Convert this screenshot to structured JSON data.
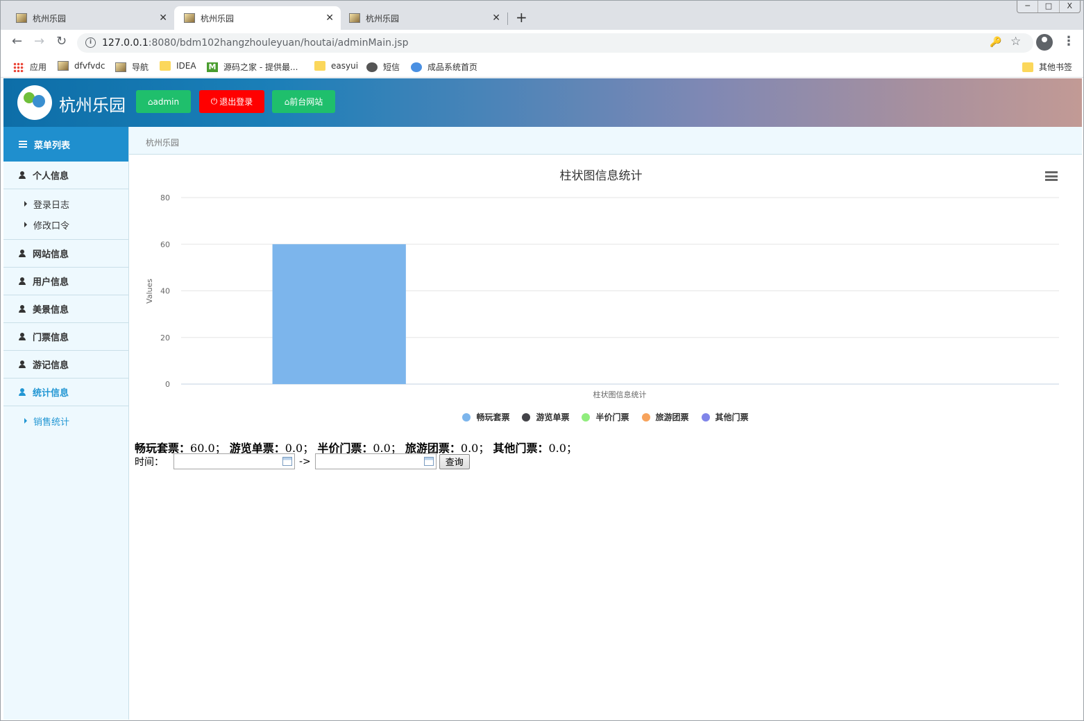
{
  "browser": {
    "tabs": [
      {
        "title": "杭州乐园",
        "active": false
      },
      {
        "title": "杭州乐园",
        "active": true
      },
      {
        "title": "杭州乐园",
        "active": false
      }
    ],
    "new_tab": "+",
    "window_controls": [
      "─",
      "□",
      "X"
    ],
    "url_host": "127.0.0.1",
    "url_rest": ":8080/bdm102hangzhouleyuan/houtai/adminMain.jsp",
    "bookmarks": [
      {
        "label": "应用",
        "icon": "apps-icon"
      },
      {
        "label": "dfvfvdc",
        "icon": "image-icon"
      },
      {
        "label": "导航",
        "icon": "image-icon"
      },
      {
        "label": "IDEA",
        "icon": "folder-icon"
      },
      {
        "label": "源码之家 - 提供最...",
        "icon": "m-icon"
      },
      {
        "label": "easyui",
        "icon": "folder-icon"
      },
      {
        "label": "短信",
        "icon": "globe-icon"
      },
      {
        "label": "成品系统首页",
        "icon": "site-icon"
      }
    ],
    "other_bookmarks": "其他书签"
  },
  "header": {
    "title": "杭州乐园",
    "buttons": [
      {
        "label": "admin",
        "icon": "home-icon",
        "color": "#1fbf6c"
      },
      {
        "label": "退出登录",
        "icon": "power-icon",
        "color": "#ff0000"
      },
      {
        "label": "前台网站",
        "icon": "home-icon",
        "color": "#1fbf6c"
      }
    ]
  },
  "sidebar": {
    "title": "菜单列表",
    "personal": "个人信息",
    "personal_items": [
      "登录日志",
      "修改口令"
    ],
    "site_info": "网站信息",
    "user_info": "用户信息",
    "scenery_info": "美景信息",
    "ticket_info": "门票信息",
    "travel_info": "游记信息",
    "stats_info": "统计信息",
    "stats_items": [
      "销售统计"
    ]
  },
  "breadcrumb": "杭州乐园",
  "chart_data": {
    "type": "bar",
    "title": "柱状图信息统计",
    "xlabel": "柱状图信息统计",
    "ylabel": "Values",
    "ylim": [
      0,
      80
    ],
    "yticks": [
      "0",
      "20",
      "40",
      "60",
      "80"
    ],
    "categories": [
      "柱状图信息统计"
    ],
    "series": [
      {
        "name": "畅玩套票",
        "values": [
          60
        ],
        "color": "#7cb5ec"
      },
      {
        "name": "游览单票",
        "values": [
          0
        ],
        "color": "#434348"
      },
      {
        "name": "半价门票",
        "values": [
          0
        ],
        "color": "#90ed7d"
      },
      {
        "name": "旅游团票",
        "values": [
          0
        ],
        "color": "#f7a35c"
      },
      {
        "name": "其他门票",
        "values": [
          0
        ],
        "color": "#8085e9"
      }
    ],
    "legend": "bottom",
    "grid": true
  },
  "summary": [
    {
      "label": "畅玩套票：",
      "value": "60.0；"
    },
    {
      "label": "游览单票：",
      "value": "0.0；"
    },
    {
      "label": "半价门票：",
      "value": "0.0；"
    },
    {
      "label": "旅游团票：",
      "value": "0.0；"
    },
    {
      "label": "其他门票：",
      "value": "0.0；"
    }
  ],
  "filter": {
    "time_label": "时间：",
    "arrow": "->",
    "start": "",
    "end": "",
    "query": "查询"
  }
}
